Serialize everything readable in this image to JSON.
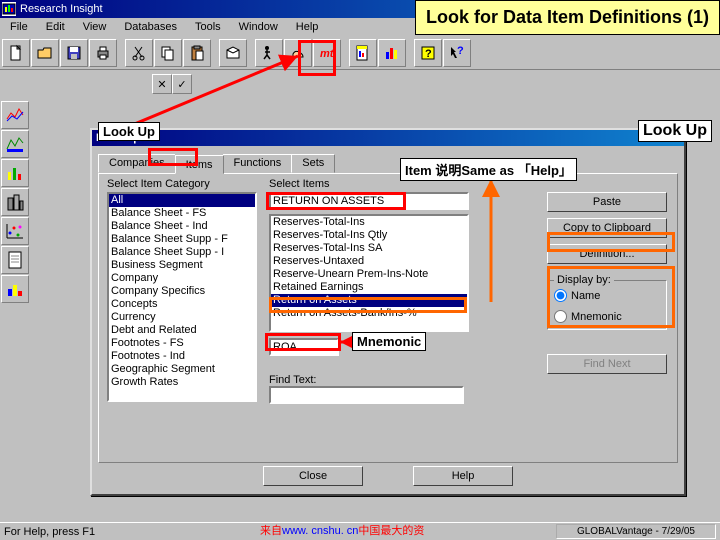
{
  "slide_title": "Look for Data Item Definitions (1)",
  "app": {
    "title": "Research Insight"
  },
  "menus": [
    "File",
    "Edit",
    "View",
    "Databases",
    "Tools",
    "Window",
    "Help"
  ],
  "toolbar_icons": [
    "new",
    "open",
    "save",
    "print",
    "cut",
    "copy",
    "paste",
    "lookup",
    "run",
    "assistant",
    "chart-red",
    "report-color",
    "chart-bar",
    "help-yellow",
    "help-arrow"
  ],
  "secondary_icons": [
    "x",
    "check"
  ],
  "side_icons": [
    "chart-1",
    "stock",
    "bar3d",
    "buildings",
    "scatter",
    "report",
    "bar2"
  ],
  "annotations": {
    "lookup_left": "Look Up",
    "lookup_right": "Look Up",
    "item_note": "Item 说明Same as 「Help」",
    "mnemonic": "Mnemonic"
  },
  "dialog": {
    "title": "Look Up",
    "tabs": [
      "Companies",
      "Items",
      "Functions",
      "Sets"
    ],
    "active_tab": 1,
    "cat_label": "Select Item Category",
    "items_label": "Select Items",
    "categories": [
      "All",
      "Balance Sheet - FS",
      "Balance Sheet - Ind",
      "Balance Sheet Supp - F",
      "Balance Sheet Supp - I",
      "Business Segment",
      "Company",
      "Company Specifics",
      "Concepts",
      "Currency",
      "Debt and Related",
      "Footnotes - FS",
      "Footnotes - Ind",
      "Geographic Segment",
      "Growth Rates"
    ],
    "selected_text_value": "RETURN ON ASSETS",
    "items": [
      "Reserves-Total-Ins",
      "Reserves-Total-Ins Qtly",
      "Reserves-Total-Ins SA",
      "Reserves-Untaxed",
      "Reserve-Unearn Prem-Ins-Note",
      "Retained Earnings",
      "Return on Assets",
      "Return on Assets-Bank/Ins-%"
    ],
    "items_selected_index": 6,
    "mnemonic_value": "ROA",
    "find_label": "Find Text:",
    "find_next": "Find Next",
    "buttons": {
      "paste": "Paste",
      "copy": "Copy to Clipboard",
      "definition": "Definition...",
      "close": "Close",
      "help": "Help"
    },
    "display_by": {
      "label": "Display by:",
      "name": "Name",
      "mnemonic": "Mnemonic",
      "selected": "name"
    }
  },
  "status": {
    "left": "For Help, press F1",
    "right": "GLOBALVantage - 7/29/05"
  },
  "footer": {
    "prefix": "来自",
    "link": "www. cnshu. cn",
    "suffix": "中国最大的资"
  }
}
